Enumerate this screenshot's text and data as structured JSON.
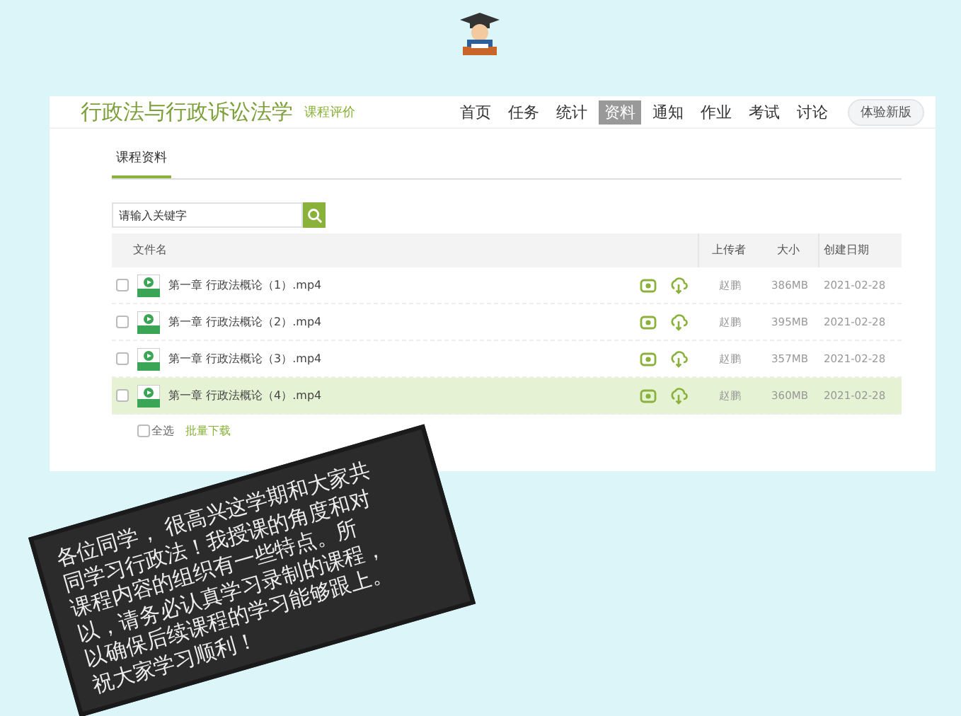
{
  "header": {
    "title": "行政法与行政诉讼法学",
    "subtitle": "课程评价",
    "nav": [
      {
        "label": "首页",
        "selected": false
      },
      {
        "label": "任务",
        "selected": false
      },
      {
        "label": "统计",
        "selected": false
      },
      {
        "label": "资料",
        "selected": true
      },
      {
        "label": "通知",
        "selected": false
      },
      {
        "label": "作业",
        "selected": false
      },
      {
        "label": "考试",
        "selected": false
      },
      {
        "label": "讨论",
        "selected": false
      }
    ],
    "new_version": "体验新版"
  },
  "tabs": [
    {
      "label": "课程资料",
      "selected": true
    }
  ],
  "search": {
    "placeholder": "请输入关键字"
  },
  "table": {
    "columns": [
      "文件名",
      "上传者",
      "大小",
      "创建日期"
    ],
    "rows": [
      {
        "name": "第一章 行政法概论（1）.mp4",
        "uploader": "赵鹏",
        "size": "386MB",
        "date": "2021-02-28",
        "checked": false,
        "selected": false
      },
      {
        "name": "第一章 行政法概论（2）.mp4",
        "uploader": "赵鹏",
        "size": "395MB",
        "date": "2021-02-28",
        "checked": false,
        "selected": false
      },
      {
        "name": "第一章 行政法概论（3）.mp4",
        "uploader": "赵鹏",
        "size": "357MB",
        "date": "2021-02-28",
        "checked": false,
        "selected": false
      },
      {
        "name": "第一章 行政法概论（4）.mp4",
        "uploader": "赵鹏",
        "size": "360MB",
        "date": "2021-02-28",
        "checked": false,
        "selected": true
      }
    ]
  },
  "footer": {
    "select_all": "全选",
    "select_all_checked": false,
    "batch_download": "批量下载"
  },
  "blackboard": {
    "lines": [
      "各位同学， 很高兴这学期和大家共",
      "同学习行政法！我授课的角度和对",
      "课程内容的组织有一些特点。所",
      "以，请务必认真学习录制的课程，",
      "以确保后续课程的学习能够跟上。",
      "祝大家学习顺利！"
    ]
  }
}
